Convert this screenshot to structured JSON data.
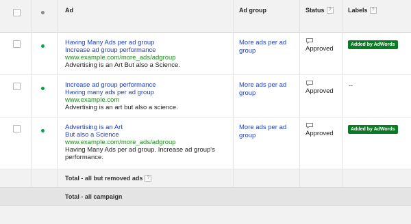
{
  "header": {
    "ad": "Ad",
    "ad_group": "Ad group",
    "status": "Status",
    "labels": "Labels",
    "help": "?"
  },
  "rows": [
    {
      "headline1": "Having Many Ads per ad group",
      "headline2": "Increase ad group performance",
      "url": "www.example.com/more_ads/adgroup",
      "description": "Advertising is an Art But also a Science.",
      "ad_group": "More ads per ad group",
      "status": "Approved",
      "label": "Added by AdWords"
    },
    {
      "headline1": "Increase ad group performance",
      "headline2": "Having many ads per ad group",
      "url": "www.example.com",
      "description": "Advertising is an art but also a science.",
      "ad_group": "More ads per ad group",
      "status": "Approved",
      "label": "--"
    },
    {
      "headline1": "Advertising is an Art",
      "headline2": "But also a Science",
      "url": "www.example.com/more_ads/adgroup",
      "description": "Having Many Ads per ad group. Increase ad group's performance.",
      "ad_group": "More ads per ad group",
      "status": "Approved",
      "label": "Added by AdWords"
    }
  ],
  "totals": {
    "all_but_removed": "Total - all but removed ads",
    "all_campaign": "Total - all campaign"
  },
  "icons": {
    "status_dot": "green-dot-icon",
    "status_comment": "comment-bubble-icon"
  },
  "colors": {
    "link_blue": "#1f3fbf",
    "url_green": "#1a8a1a",
    "badge_green": "#0c7a25",
    "status_green": "#0aa14a"
  }
}
